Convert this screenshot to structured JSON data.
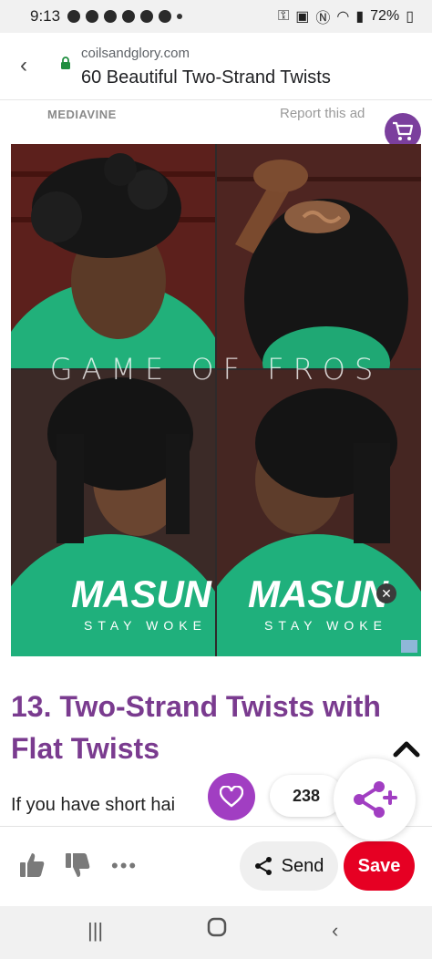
{
  "status": {
    "time": "9:13",
    "battery": "72%"
  },
  "browser": {
    "domain": "coilsandglory.com",
    "page_title": "60 Beautiful Two-Strand Twists"
  },
  "ad": {
    "brand": "MEDIAVINE",
    "report_label": "Report this ad"
  },
  "image": {
    "watermark": "GAME OF FROS",
    "shirt_text_1": "MASUN",
    "shirt_text_2": "STAY WOKE"
  },
  "article": {
    "heading": "13. Two-Strand Twists with Flat Twists",
    "body_snippet": "If you have short hai"
  },
  "pin": {
    "like_count": "238"
  },
  "actions": {
    "send_label": "Send",
    "save_label": "Save"
  },
  "colors": {
    "heading": "#7a3b8f",
    "save": "#e60023",
    "accent_purple": "#a13ec2",
    "cart_purple": "#7b3f9d"
  }
}
